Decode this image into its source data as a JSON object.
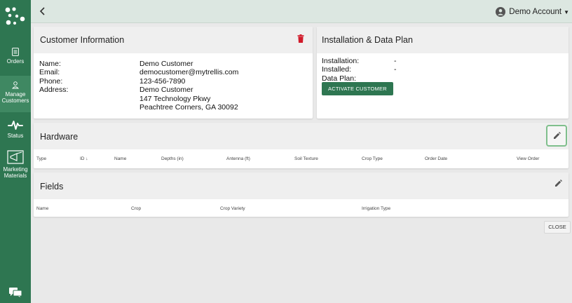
{
  "sidebar": {
    "items": [
      {
        "label": "Orders",
        "icon": "document-icon"
      },
      {
        "label": "Manage\nCustomers",
        "icon": "person-icon"
      },
      {
        "label": "Status",
        "icon": "pulse-icon"
      },
      {
        "label": "Marketing\nMaterials",
        "icon": "megaphone-icon"
      }
    ]
  },
  "topbar": {
    "account_label": "Demo Account"
  },
  "customer": {
    "title": "Customer Information",
    "labels": [
      "Name:",
      "Email:",
      "Phone:",
      "Address:"
    ],
    "values": [
      "Demo Customer",
      "democustomer@mytrellis.com",
      "123-456-7890",
      "Demo Customer",
      "147 Technology Pkwy",
      "Peachtree Corners, GA 30092"
    ]
  },
  "installation": {
    "title": "Installation & Data Plan",
    "labels": [
      "Installation:",
      "Installed:",
      "Data Plan:"
    ],
    "values": [
      "-",
      "-",
      ""
    ],
    "activate_label": "ACTIVATE CUSTOMER"
  },
  "hardware": {
    "title": "Hardware",
    "columns": [
      "Type",
      "ID ↓",
      "Name",
      "Depths (in)",
      "Antenna (ft)",
      "Soil Texture",
      "Crop Type",
      "Order Date",
      "View Order"
    ]
  },
  "fields": {
    "title": "Fields",
    "columns": [
      "Name",
      "Crop",
      "Crop Variety",
      "Irrigation Type"
    ]
  },
  "close_label": "CLOSE",
  "colors": {
    "brand": "#2e7651",
    "delete": "#d11a2a",
    "highlight": "#7fbf8c"
  }
}
